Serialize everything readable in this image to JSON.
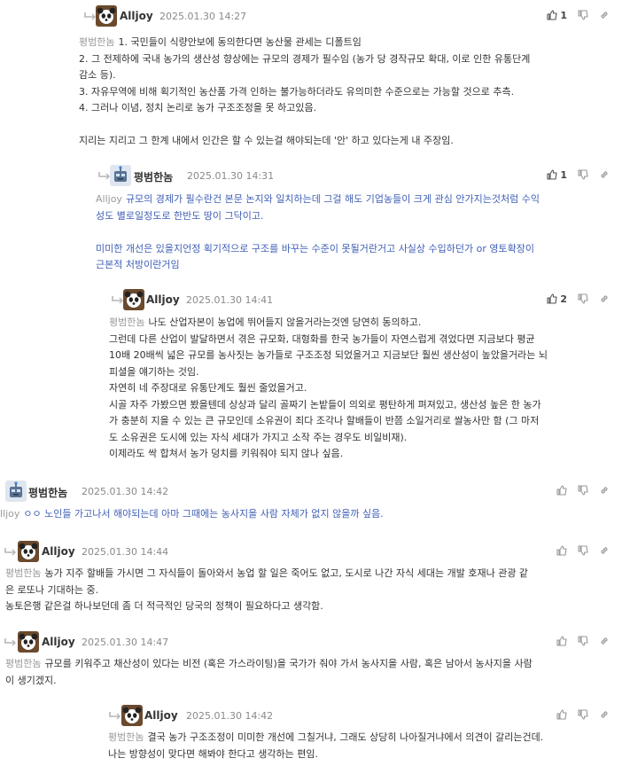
{
  "theme": {
    "reply_text_color": "#3f5fb5",
    "mention_color": "#9a9a9a",
    "date_color": "#8a8a8a",
    "icon_color": "#999999"
  },
  "comments": [
    {
      "nick": "Alljoy",
      "date": "2025.01.30 14:27",
      "likes": "1",
      "avatar": "panda-avatar-icon",
      "body": [
        {
          "mention": "평범한놈",
          "text": "1. 국민들이 식량안보에 동의한다면 농산물 관세는 디폴트임"
        },
        {
          "text": "2. 그 전제하에 국내 농가의 생산성 향상에는 규모의 경제가 필수임 (농가 당 경작규모 확대, 이로 인한 유통단계"
        },
        {
          "text": "감소 등)."
        },
        {
          "text": "3. 자유무역에 비해 획기적인 농산품 가격 인하는 불가능하더라도 유의미한 수준으로는 가능할 것으로 추측."
        },
        {
          "text": "4. 그러나 이념, 정치 논리로 농가 구조조정을 못 하고있음."
        },
        {
          "text": ""
        },
        {
          "text": "지리는 지리고 그 한계 내에서 인간은 할 수 있는걸 해야되는데 '안' 하고 있다는게 내 주장임."
        }
      ]
    },
    {
      "nick": "평범한놈",
      "date": "2025.01.30 14:31",
      "likes": "1",
      "avatar": "robot-avatar-icon",
      "body": [
        {
          "mention": "Alljoy",
          "text": "규모의 경제가 필수란건 본문 논지와 일치하는데 그걸 해도 기업농들이 크게 관심 안가지는것처럼 수익"
        },
        {
          "text": "성도 별로일정도로 한반도 땅이 그닥이고."
        },
        {
          "text": ""
        },
        {
          "text": "미미한 개선은 있을지언정 획기적으로 구조를 바꾸는 수준이 못될거란거고 사실상 수입하던가 or 영토확장이"
        },
        {
          "text": "근본적 처방이란거임"
        }
      ]
    },
    {
      "nick": "Alljoy",
      "date": "2025.01.30 14:41",
      "likes": "2",
      "avatar": "panda-avatar-icon",
      "body": [
        {
          "mention": "평범한놈",
          "text": "나도 산업자본이 농업에 뛰어들지 않을거라는것엔 당연히 동의하고."
        },
        {
          "text": "그런데 다른 산업이 발달하면서 겪은 규모화, 대형화를 한국 농가들이 자연스럽게 겪었다면 지금보다 평균"
        },
        {
          "text": "10배 20배씩 넓은 규모를 농사짓는 농가들로 구조조정 되었을거고 지금보단 훨씬 생산성이 높았을거라는 뇌"
        },
        {
          "text": "피셜을 얘기하는 것임."
        },
        {
          "text": "자연히 네 주장대로 유통단계도 훨씬 줄었을거고."
        },
        {
          "text": "시골 자주 가봤으면 봤을텐데 상상과 달리 골짜기 논밭들이 의외로 평탄하게 펴져있고, 생산성 높은 한 농가"
        },
        {
          "text": "가 충분히 지을 수 있는 큰 규모인데 소유권이 죄다 조각나 할배들이 반쯤 소일거리로 쌀농사만 함 (그 마저"
        },
        {
          "text": "도 소유권은 도시에 있는 자식 세대가 가지고 소작 주는 경우도 비일비재)."
        },
        {
          "text": "이제라도 싹 합쳐서 농가 덩치를 키워줘야 되지 않나 싶음."
        }
      ]
    },
    {
      "nick": "평범한놈",
      "date": "2025.01.30 14:42",
      "likes": "",
      "avatar": "robot-avatar-icon",
      "body": [
        {
          "mention": "lljoy",
          "text": "ㅇㅇ 노인들 가고나서 해야되는데 아마 그때에는 농사지을 사람 자체가 없지 않을까 싶음."
        }
      ]
    },
    {
      "nick": "Alljoy",
      "date": "2025.01.30 14:44",
      "likes": "",
      "avatar": "panda-avatar-icon",
      "body": [
        {
          "mention": "평범한놈",
          "text": "농가 지주 할배들 가시면 그 자식들이 돌아와서 농업 할 일은 죽어도 없고, 도시로 나간 자식 세대는 개발 호재나 관광 같"
        },
        {
          "text": "은 로또나 기대하는 중."
        },
        {
          "text": "농토은행 같은걸 하나보던데 좀 더 적극적인 당국의 정책이 필요하다고 생각함."
        }
      ]
    },
    {
      "nick": "Alljoy",
      "date": "2025.01.30 14:47",
      "likes": "",
      "avatar": "panda-avatar-icon",
      "body": [
        {
          "mention": "평범한놈",
          "text": "규모를 키워주고 채산성이 있다는 비전 (혹은 가스라이팅)을 국가가 줘야 가서 농사지을 사람, 혹은 남아서 농사지을 사람"
        },
        {
          "text": "이 생기겠지."
        }
      ]
    },
    {
      "nick": "Alljoy",
      "date": "2025.01.30 14:42",
      "likes": "",
      "avatar": "panda-avatar-icon",
      "body": [
        {
          "mention": "평범한놈",
          "text": "결국 농가 구조조정이 미미한 개선에 그칠거냐, 그래도 상당히 나아질거냐에서 의견이 갈리는건데."
        },
        {
          "text": "나는 방향성이 맞다면 해봐야 한다고 생각하는 편임."
        }
      ]
    }
  ]
}
